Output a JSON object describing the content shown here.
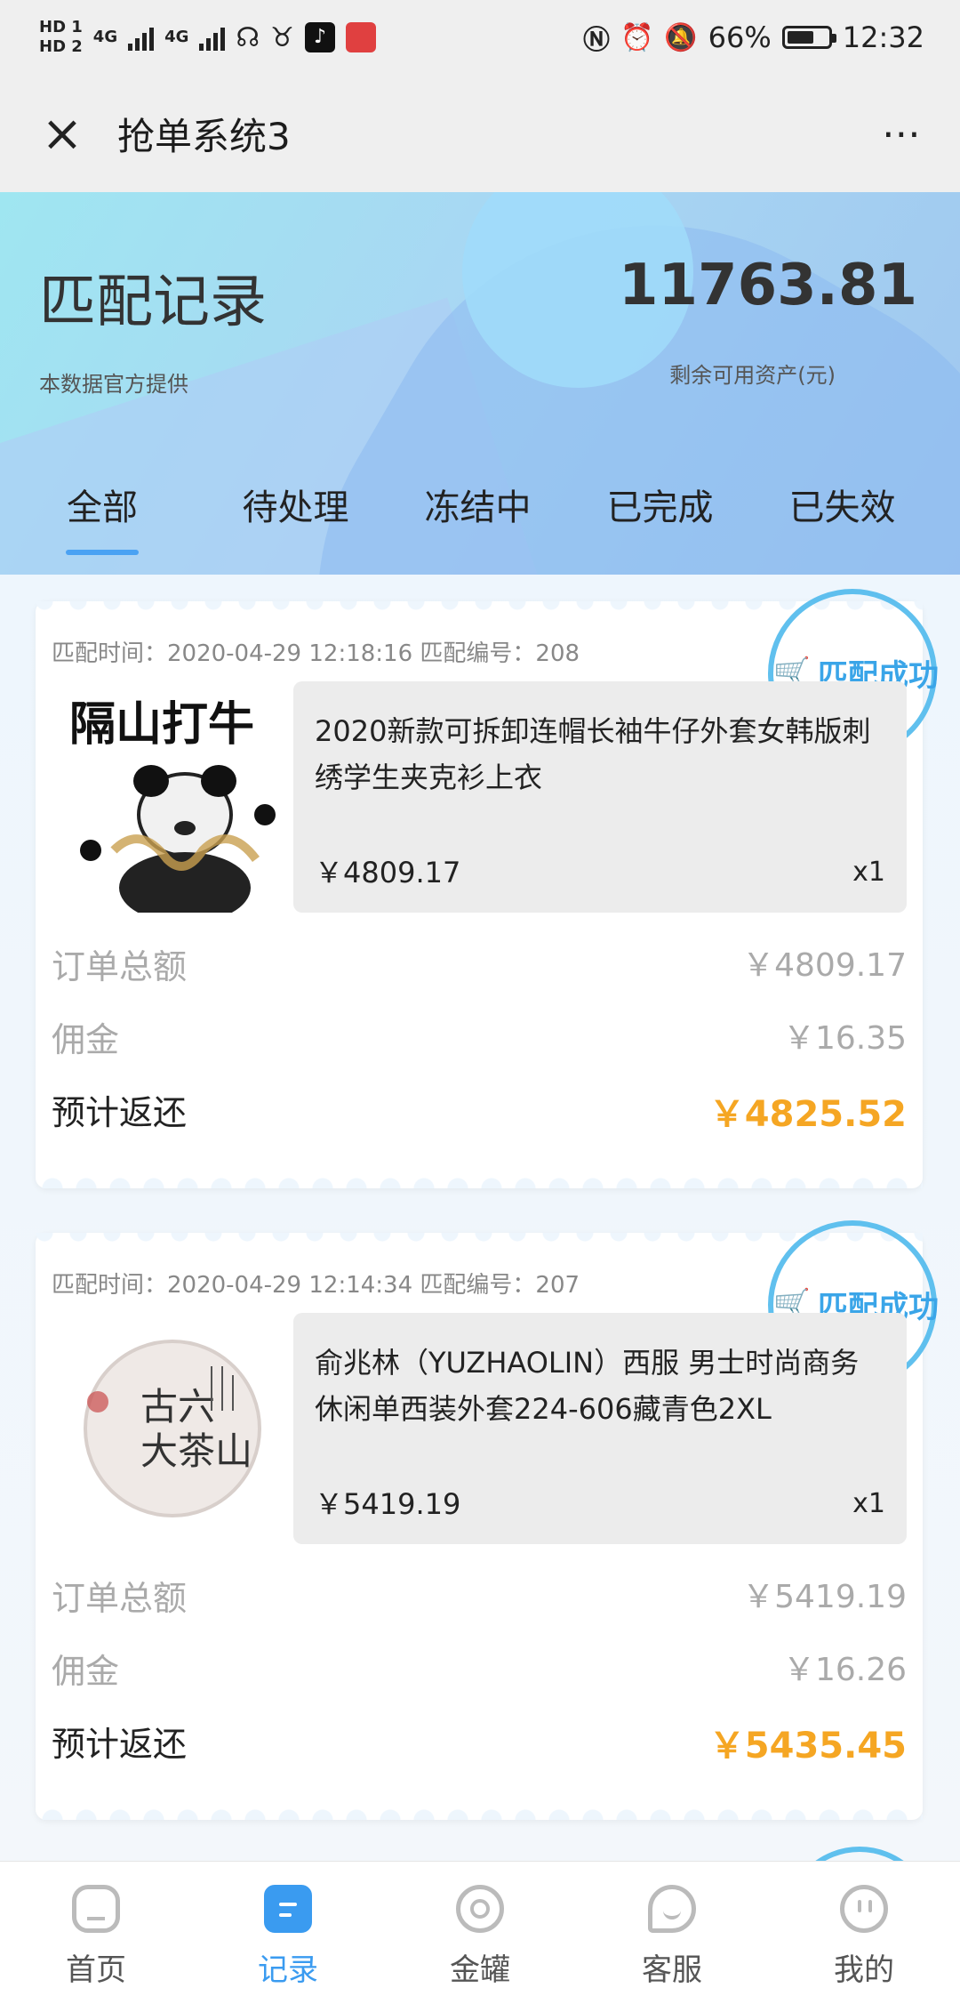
{
  "status_bar": {
    "hd1": "HD 1",
    "hd2": "HD 2",
    "net1": "4G",
    "net2": "4G",
    "battery_percent": "66%",
    "battery_level": 0.66,
    "time": "12:32"
  },
  "titlebar": {
    "title": "抢单系统3",
    "close_icon": "×",
    "more_icon": "⋯"
  },
  "hero": {
    "title": "匹配记录",
    "subtitle": "本数据官方提供",
    "amount": "11763.81",
    "amount_label": "剩余可用资产(元)"
  },
  "tabs": [
    {
      "label": "全部",
      "active": true
    },
    {
      "label": "待处理",
      "active": false
    },
    {
      "label": "冻结中",
      "active": false
    },
    {
      "label": "已完成",
      "active": false
    },
    {
      "label": "已失效",
      "active": false
    }
  ],
  "orders": [
    {
      "meta": "匹配时间：2020-04-29 12:18:16  匹配编号：208",
      "stamp": "匹配成功",
      "thumb_caption": "隔山打牛",
      "product_name": "2020新款可拆卸连帽长袖牛仔外套女韩版刺绣学生夹克衫上衣",
      "price": "￥4809.17",
      "qty": "x1",
      "total_label": "订单总额",
      "total": "￥4809.17",
      "commission_label": "佣金",
      "commission": "￥16.35",
      "return_label": "预计返还",
      "return": "￥4825.52"
    },
    {
      "meta": "匹配时间：2020-04-29 12:14:34  匹配编号：207",
      "stamp": "匹配成功",
      "product_name": "俞兆林（YUZHAOLIN）西服 男士时尚商务休闲单西装外套224-606藏青色2XL",
      "price": "￥5419.19",
      "qty": "x1",
      "total_label": "订单总额",
      "total": "￥5419.19",
      "commission_label": "佣金",
      "commission": "￥16.26",
      "return_label": "预计返还",
      "return": "￥5435.45"
    }
  ],
  "bottom_nav": [
    {
      "label": "首页",
      "icon": "home-icon",
      "active": false
    },
    {
      "label": "记录",
      "icon": "record-icon",
      "active": true
    },
    {
      "label": "金罐",
      "icon": "jar-icon",
      "active": false
    },
    {
      "label": "客服",
      "icon": "service-icon",
      "active": false
    },
    {
      "label": "我的",
      "icon": "profile-icon",
      "active": false
    }
  ],
  "colors": {
    "accent": "#3a9bf0",
    "return_amount": "#f5a623",
    "stamp": "#4fb9ec"
  }
}
